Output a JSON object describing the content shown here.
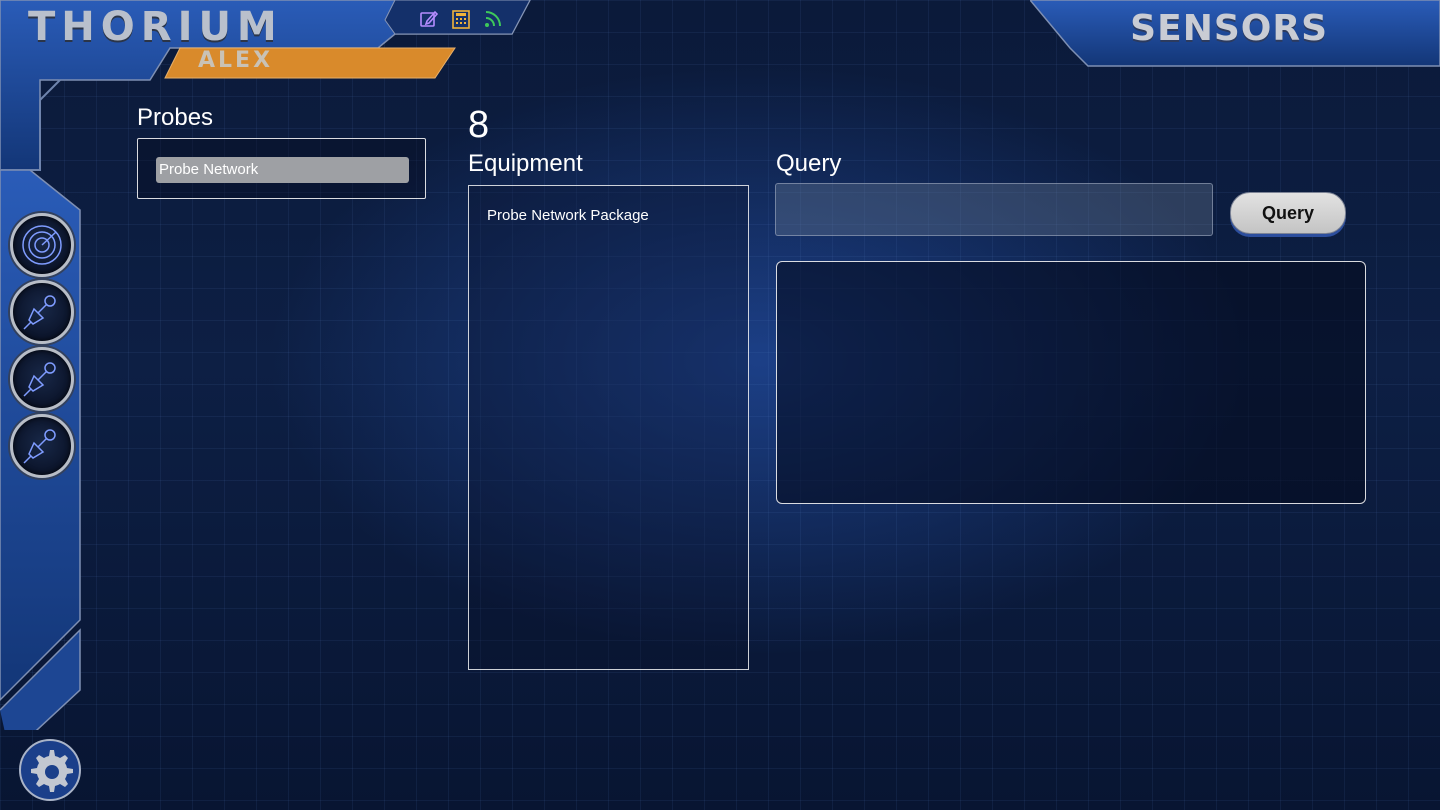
{
  "app": {
    "brand": "THORIUM",
    "station": "ALEX",
    "screen_title": "SENSORS"
  },
  "toolbar": {
    "icons": [
      "edit-icon",
      "calculator-icon",
      "rss-feed-icon"
    ]
  },
  "sidebar": {
    "buttons": [
      "radar-icon",
      "probe-icon",
      "probe-icon",
      "probe-icon"
    ],
    "settings_icon": "gear-icon"
  },
  "probes": {
    "heading": "Probes",
    "items": [
      "Probe Network"
    ]
  },
  "equipment": {
    "count": "8",
    "heading": "Equipment",
    "items": [
      "Probe Network Package"
    ]
  },
  "query": {
    "heading": "Query",
    "input_value": "",
    "button_label": "Query",
    "results": ""
  },
  "colors": {
    "accent_orange": "#d98a2b",
    "frame_blue": "#1f4da0",
    "background": "#0b1a3a"
  }
}
